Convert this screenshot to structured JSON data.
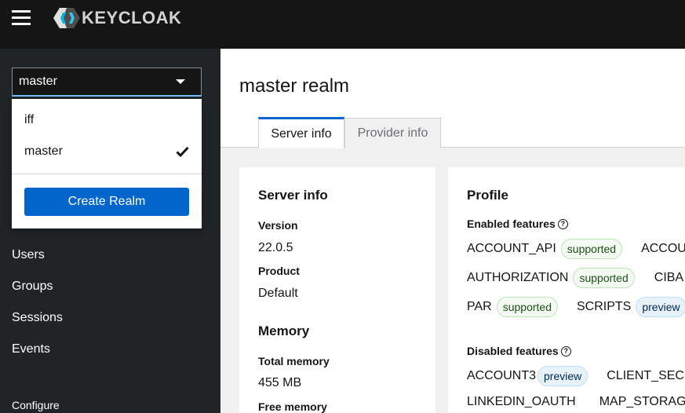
{
  "header": {
    "logo_text": "KEYCLOAK",
    "menu_icon": "hamburger-menu-icon"
  },
  "sidebar": {
    "realm_selector": {
      "value": "master"
    },
    "dropdown": {
      "items": [
        {
          "label": "iff",
          "selected": false
        },
        {
          "label": "master",
          "selected": true
        }
      ],
      "create_button": "Create Realm"
    },
    "nav_items": [
      "Users",
      "Groups",
      "Sessions",
      "Events"
    ],
    "section_label": "Configure"
  },
  "main": {
    "title": "master realm",
    "tabs": [
      {
        "label": "Server info",
        "active": true
      },
      {
        "label": "Provider info",
        "active": false
      }
    ],
    "server_info": {
      "title": "Server info",
      "version_label": "Version",
      "version_value": "22.0.5",
      "product_label": "Product",
      "product_value": "Default",
      "memory_title": "Memory",
      "total_memory_label": "Total memory",
      "total_memory_value": "455 MB",
      "free_memory_label": "Free memory"
    },
    "profile": {
      "title": "Profile",
      "enabled_label": "Enabled features",
      "enabled_rows": [
        [
          {
            "name": "ACCOUNT_API",
            "badge": "supported"
          },
          {
            "name": "ACCOUNT_",
            "badge": ""
          }
        ],
        [
          {
            "name": "AUTHORIZATION",
            "badge": "supported"
          },
          {
            "name": "CIBA",
            "badge": ""
          }
        ],
        [
          {
            "name": "PAR",
            "badge": "supported"
          },
          {
            "name": "SCRIPTS",
            "badge": "preview"
          }
        ]
      ],
      "disabled_label": "Disabled features",
      "disabled_rows": [
        [
          {
            "name": "ACCOUNT3",
            "badge": "preview"
          },
          {
            "name": "CLIENT_SECRET",
            "badge": ""
          }
        ],
        [
          {
            "name": "LINKEDIN_OAUTH",
            "badge": ""
          },
          {
            "name": "MAP_STORAGE",
            "badge": ""
          }
        ]
      ]
    }
  },
  "colors": {
    "header_bg": "#151515",
    "sidebar_bg": "#212427",
    "primary": "#0066cc"
  }
}
